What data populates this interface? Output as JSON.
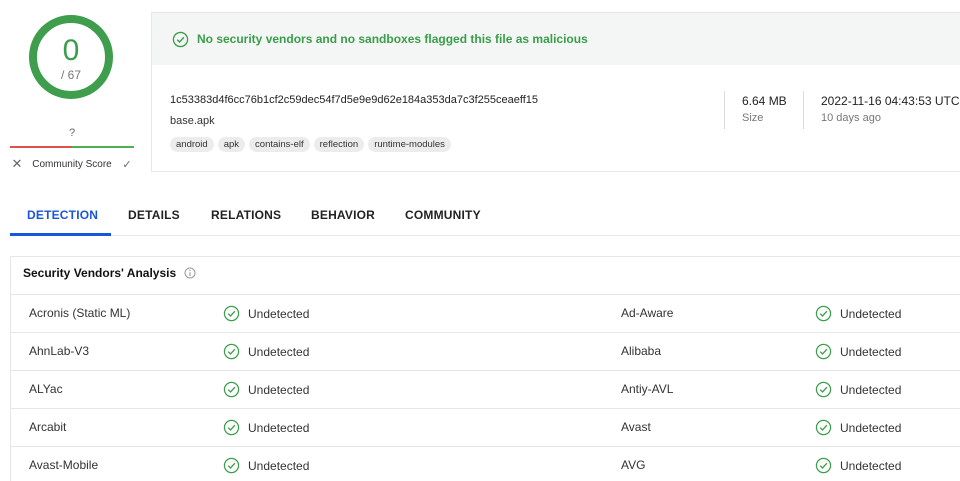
{
  "score": {
    "detections": "0",
    "total": "/ 67",
    "community_value": "?",
    "community_label": "Community Score",
    "down_icon": "x-icon",
    "up_icon": "check-icon"
  },
  "banner": {
    "text": "No security vendors and no sandboxes flagged this file as malicious",
    "icon": "check-circle-icon",
    "color": "#3a9d4a"
  },
  "file": {
    "hash": "1c53383d4f6cc76b1cf2c59dec54f7d5e9e9d62e184a353da7c3f255ceaeff15",
    "name": "base.apk",
    "tags": [
      "android",
      "apk",
      "contains-elf",
      "reflection",
      "runtime-modules"
    ],
    "size_value": "6.64 MB",
    "size_label": "Size",
    "date_value": "2022-11-16 04:43:53 UTC",
    "date_relative": "10 days ago"
  },
  "tabs": [
    {
      "label": "DETECTION",
      "active": true
    },
    {
      "label": "DETAILS",
      "active": false
    },
    {
      "label": "RELATIONS",
      "active": false
    },
    {
      "label": "BEHAVIOR",
      "active": false
    },
    {
      "label": "COMMUNITY",
      "active": false
    }
  ],
  "section": {
    "title": "Security Vendors' Analysis",
    "info_icon": "info-icon"
  },
  "vendors": [
    {
      "left": {
        "name": "Acronis (Static ML)",
        "result": "Undetected"
      },
      "right": {
        "name": "Ad-Aware",
        "result": "Undetected"
      }
    },
    {
      "left": {
        "name": "AhnLab-V3",
        "result": "Undetected"
      },
      "right": {
        "name": "Alibaba",
        "result": "Undetected"
      }
    },
    {
      "left": {
        "name": "ALYac",
        "result": "Undetected"
      },
      "right": {
        "name": "Antiy-AVL",
        "result": "Undetected"
      }
    },
    {
      "left": {
        "name": "Arcabit",
        "result": "Undetected"
      },
      "right": {
        "name": "Avast",
        "result": "Undetected"
      }
    },
    {
      "left": {
        "name": "Avast-Mobile",
        "result": "Undetected"
      },
      "right": {
        "name": "AVG",
        "result": "Undetected"
      }
    }
  ],
  "colors": {
    "accent": "#1a56db",
    "clean": "#3a9d4a",
    "negative": "#e05050"
  }
}
